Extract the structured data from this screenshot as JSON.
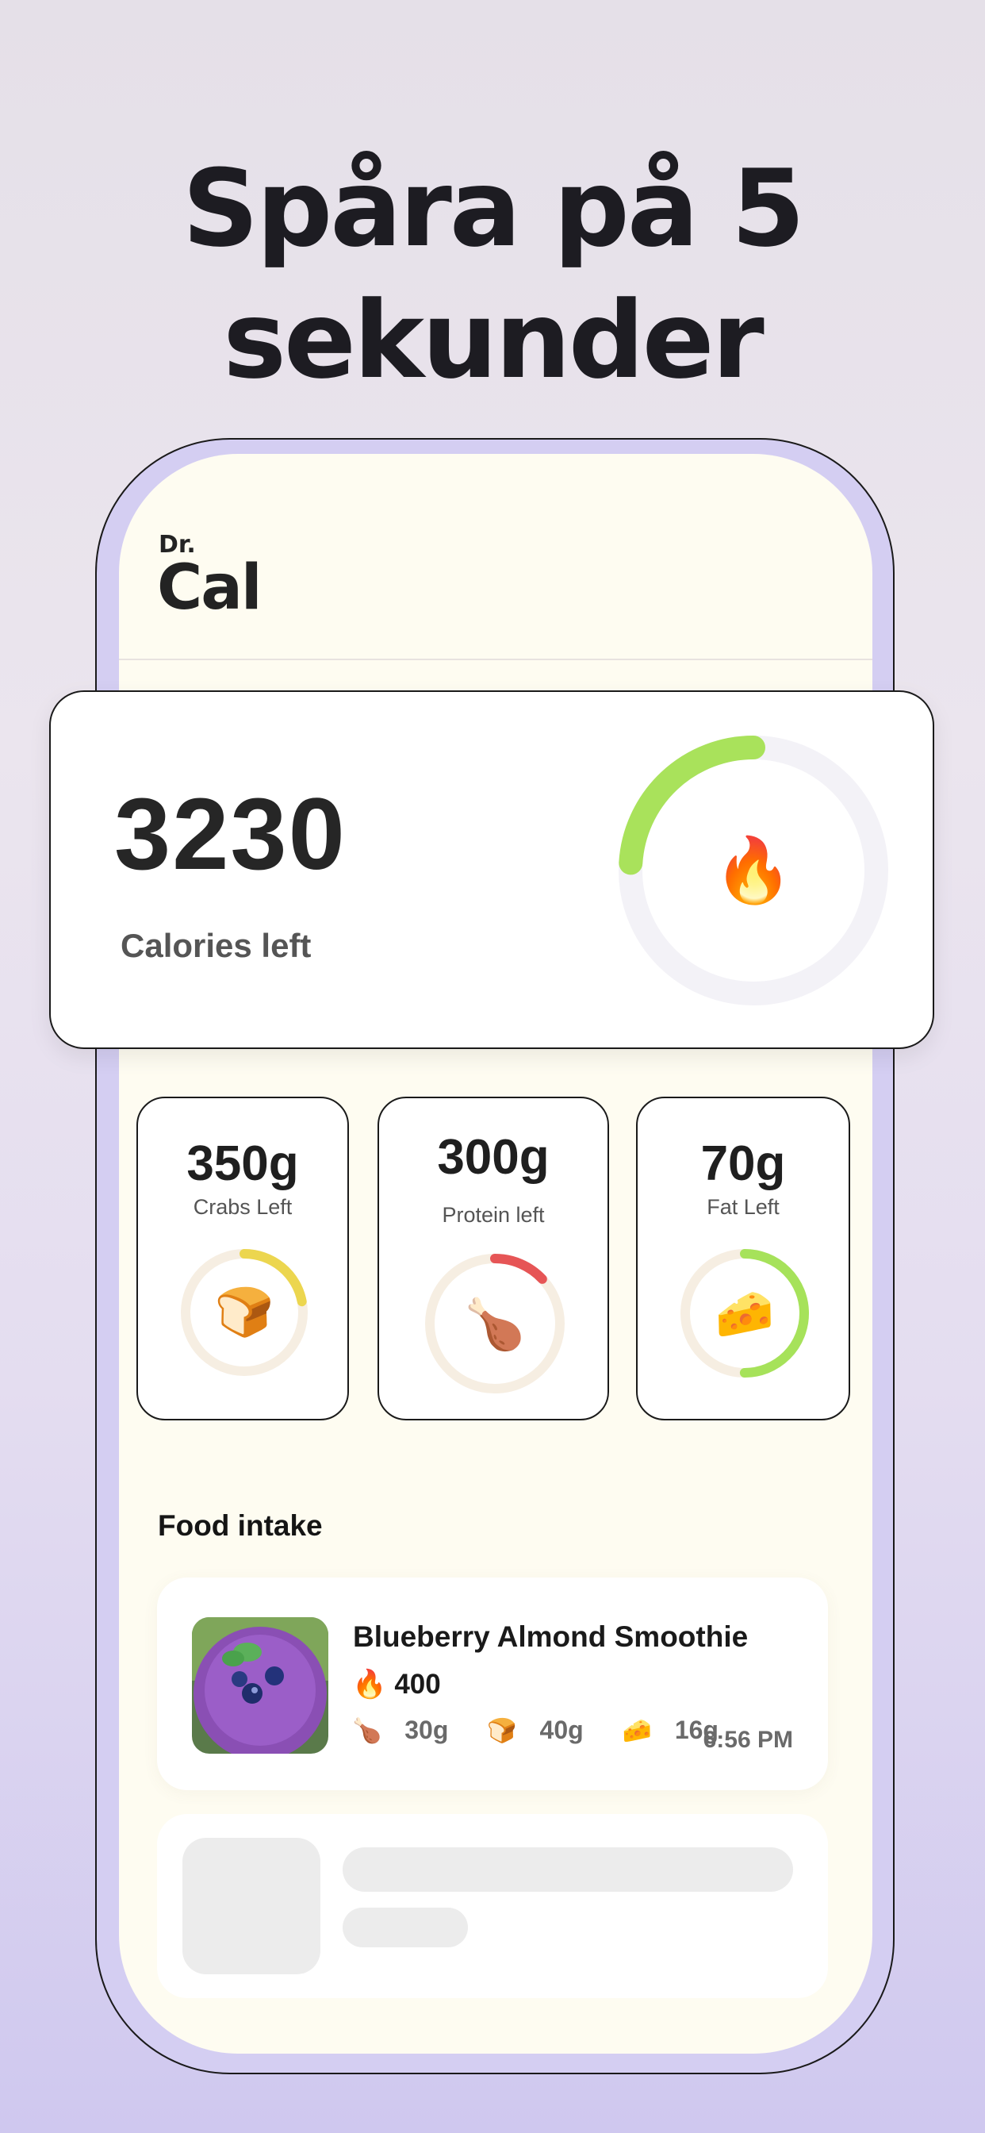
{
  "headline": {
    "line1": "Spåra på 5",
    "line2": "sekunder"
  },
  "app": {
    "logo_small": "Dr.",
    "logo_big": "Cal"
  },
  "calories": {
    "value": "3230",
    "label": "Calories left",
    "icon": "fire-icon",
    "icon_glyph": "🔥",
    "progress": 0.24,
    "ring_color": "#a9e25b",
    "track_color": "#f3f2f7"
  },
  "macros": [
    {
      "value": "350g",
      "label": "Crabs Left",
      "icon": "bread-icon",
      "glyph": "🍞",
      "progress": 0.22,
      "color": "#ecd64f"
    },
    {
      "value": "300g",
      "label": "Protein left",
      "icon": "drumstick-icon",
      "glyph": "🍗",
      "progress": 0.13,
      "color": "#e65556"
    },
    {
      "value": "70g",
      "label": "Fat Left",
      "icon": "cheese-icon",
      "glyph": "🧀",
      "progress": 0.5,
      "color": "#a6e25a"
    }
  ],
  "food_intake": {
    "title": "Food intake",
    "items": [
      {
        "name": "Blueberry Almond Smoothie",
        "calories": "400",
        "protein": "30g",
        "carbs": "40g",
        "fat": "16g",
        "time": "6:56 PM",
        "fire_glyph": "🔥",
        "protein_glyph": "🍗",
        "carbs_glyph": "🍞",
        "fat_glyph": "🧀"
      }
    ]
  }
}
